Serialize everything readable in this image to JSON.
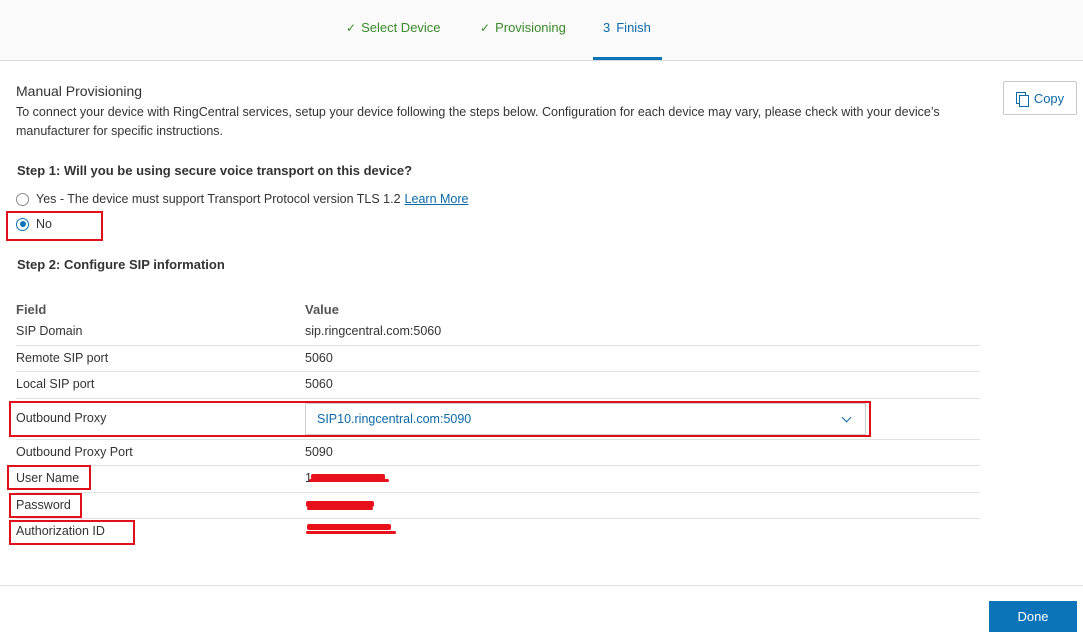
{
  "wizard": {
    "steps": [
      {
        "check": "✓",
        "label": "Select Device"
      },
      {
        "check": "✓",
        "label": "Provisioning"
      },
      {
        "number": "3",
        "label": "Finish"
      }
    ]
  },
  "header": {
    "title": "Manual Provisioning",
    "description": "To connect your device with RingCentral services, setup your device following the steps below. Configuration for each device may vary, please check with your device’s manufacturer for specific instructions.",
    "copy_label": "Copy"
  },
  "step1": {
    "heading": "Step 1: Will you be using secure voice transport on this device?",
    "option_yes": "Yes - The device must support Transport Protocol version TLS 1.2",
    "learn_more": "Learn More",
    "option_no": "No",
    "selected": "No"
  },
  "step2": {
    "heading": "Step 2: Configure SIP information",
    "col_field": "Field",
    "col_value": "Value",
    "rows": [
      {
        "field": "SIP Domain",
        "value": "sip.ringcentral.com:5060"
      },
      {
        "field": "Remote SIP port",
        "value": "5060"
      },
      {
        "field": "Local SIP port",
        "value": "5060"
      },
      {
        "field": "Outbound Proxy",
        "value": "SIP10.ringcentral.com:5090"
      },
      {
        "field": "Outbound Proxy Port",
        "value": "5090"
      },
      {
        "field": "User Name",
        "value": "1"
      },
      {
        "field": "Password",
        "value": ""
      },
      {
        "field": "Authorization ID",
        "value": ""
      }
    ]
  },
  "footer": {
    "done_label": "Done"
  },
  "colors": {
    "accent": "#0b74b8",
    "success": "#3a8a2a",
    "highlight": "#e0101a"
  }
}
